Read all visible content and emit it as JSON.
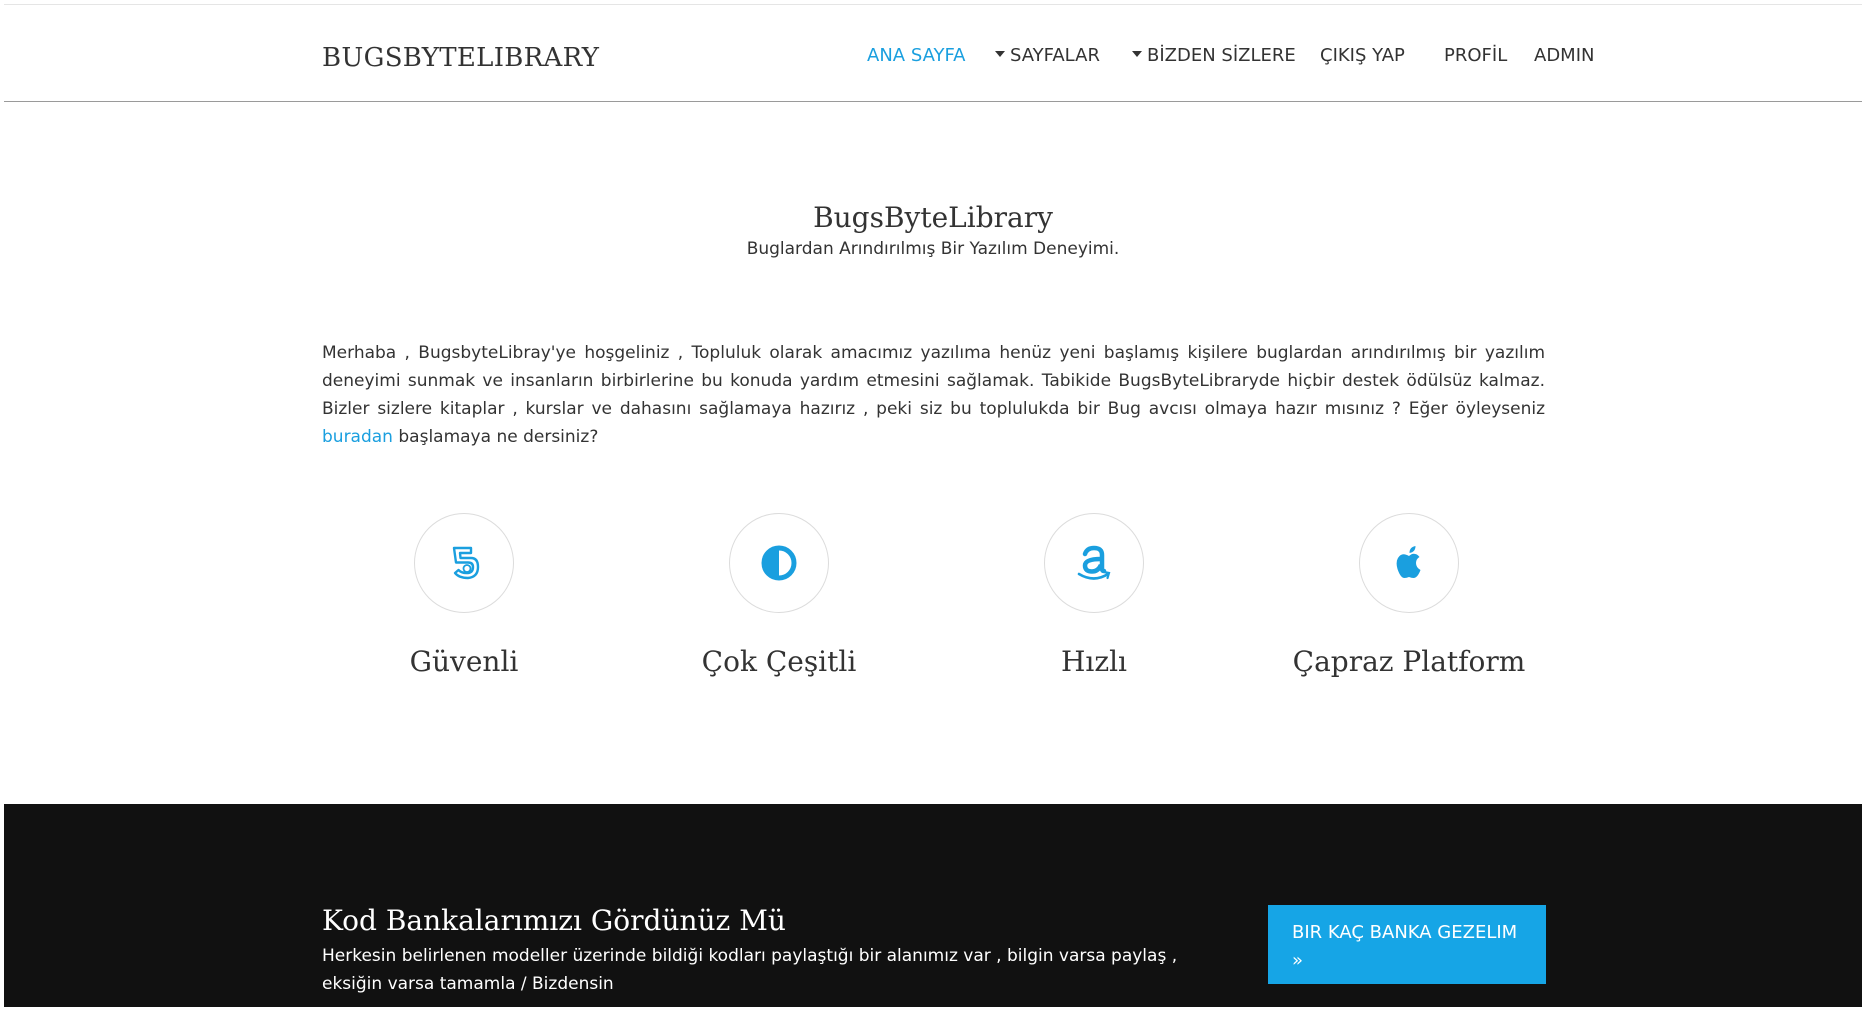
{
  "header": {
    "brand": "BUGSBYTELIBRARY",
    "nav": [
      {
        "label": "ANA SAYFA",
        "active": true
      },
      {
        "label": "SAYFALAR",
        "dropdown": true
      },
      {
        "label": "BİZDEN SİZLERE",
        "dropdown": true
      },
      {
        "label": "ÇIKIŞ YAP"
      },
      {
        "label": "PROFİL"
      },
      {
        "label": "ADMIN"
      }
    ]
  },
  "hero": {
    "title": "BugsByteLibrary",
    "tagline": "Buglardan Arındırılmış Bir Yazılım Deneyimi."
  },
  "intro": {
    "text_before": "Merhaba , BugsbyteLibray'ye hoşgeliniz , Topluluk olarak amacımız yazılıma henüz yeni başlamış kişilere buglardan arındırılmış bir yazılım deneyimi sunmak ve insanların birbirlerine bu konuda yardım etmesini sağlamak. Tabikide BugsByteLibraryde hiçbir destek ödülsüz kalmaz. Bizler sizlere kitaplar , kurslar ve dahasını sağlamaya hazırız , peki siz bu toplulukda bir Bug avcısı olmaya hazır mısınız ? Eğer öyleyseniz ",
    "link": "buradan",
    "text_after": " başlamaya ne dersiniz?"
  },
  "features": [
    {
      "label": "Güvenli",
      "icon": "html5-icon"
    },
    {
      "label": "Çok Çeşitli",
      "icon": "half-circle-icon"
    },
    {
      "label": "Hızlı",
      "icon": "amazon-icon"
    },
    {
      "label": "Çapraz Platform",
      "icon": "apple-icon"
    }
  ],
  "band": {
    "title": "Kod Bankalarımızı Gördünüz Mü",
    "text": "Herkesin belirlenen modeller üzerinde bildiği kodları paylaştığı bir alanımız var , bilgin varsa paylaş , eksiğin varsa tamamla / Bizdensin",
    "button": "BIR KAÇ BANKA GEZELIM",
    "button_arrow": "»"
  },
  "colors": {
    "accent": "#1a9fdf",
    "band": "#111111",
    "button": "#16a5e6"
  }
}
